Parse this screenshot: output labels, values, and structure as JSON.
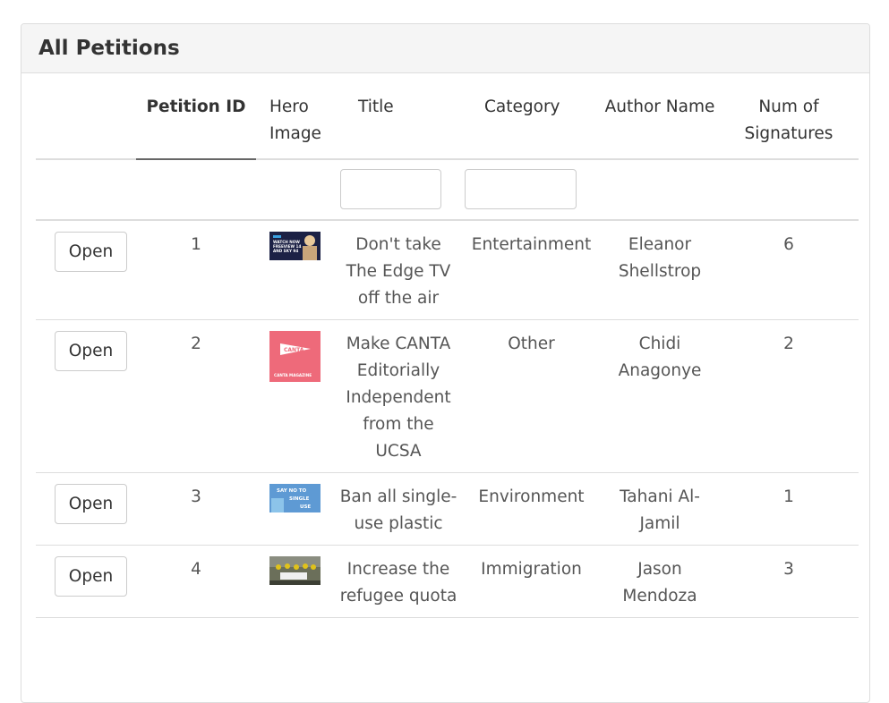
{
  "panel": {
    "title": "All Petitions"
  },
  "columns": {
    "petition_id": "Petition ID",
    "hero_image": "Hero Image",
    "title": "Title",
    "category": "Category",
    "author_name": "Author Name",
    "num_signatures": "Num of Signatures"
  },
  "filters": {
    "title_value": "",
    "category_value": ""
  },
  "rows": [
    {
      "button": "Open",
      "id": "1",
      "title": "Don't take The Edge TV off the air",
      "category": "Entertainment",
      "author": "Eleanor Shellstrop",
      "signatures": "6",
      "image_text": "WATCH NOW FREEVIEW 14 AND SKY 94"
    },
    {
      "button": "Open",
      "id": "2",
      "title": "Make CANTA Editorially Independent from the UCSA",
      "category": "Other",
      "author": "Chidi Anagonye",
      "signatures": "2",
      "image_text": "CANTA",
      "image_caption": "CANTA MAGAZINE"
    },
    {
      "button": "Open",
      "id": "3",
      "title": "Ban all single-use plastic",
      "category": "Environment",
      "author": "Tahani Al-Jamil",
      "signatures": "1",
      "image_text": "SAY NO TO SINGLE USE"
    },
    {
      "button": "Open",
      "id": "4",
      "title": "Increase the refugee quota",
      "category": "Immigration",
      "author": "Jason Mendoza",
      "signatures": "3"
    }
  ],
  "colors": {
    "header_bg": "#f5f5f5",
    "border": "#dddddd",
    "text": "#555555"
  }
}
